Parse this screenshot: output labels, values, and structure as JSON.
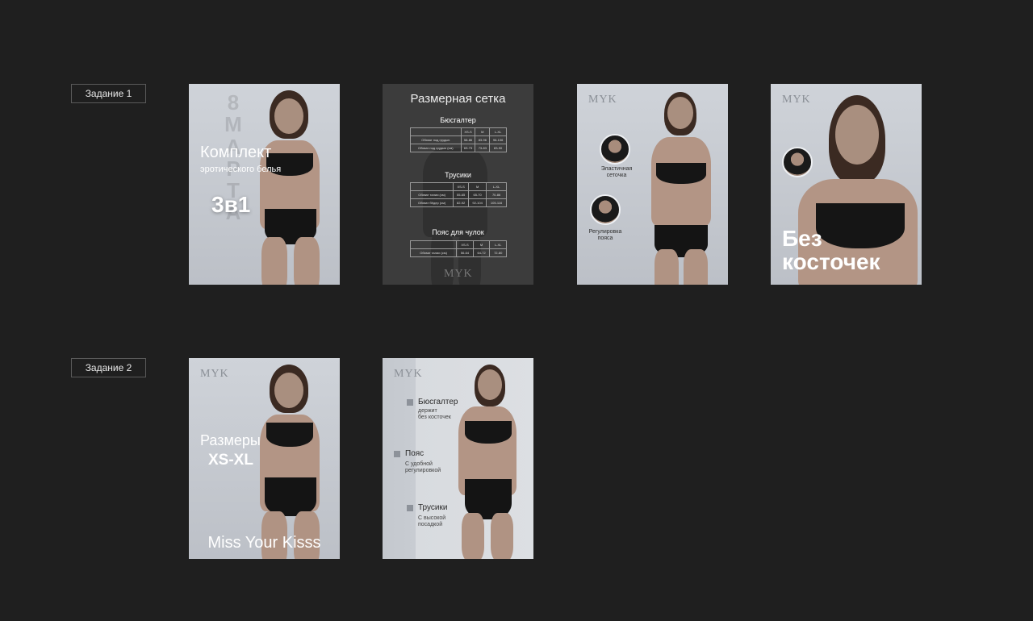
{
  "task1_label": "Задание 1",
  "task2_label": "Задание 2",
  "brand": "MYK",
  "card1": {
    "vertical": [
      "8",
      "М",
      "А",
      "Р",
      "Т",
      "А"
    ],
    "title": "Комплект",
    "subtitle": "эротического белья",
    "set": "3в1"
  },
  "card2": {
    "title": "Размерная сетка",
    "sections": [
      {
        "name": "Бюсгалтер",
        "header": [
          "",
          "XS-S",
          "M",
          "L-XL"
        ],
        "rows": [
          [
            "Обхват под грудью",
            "58-86",
            "83-96",
            "96-106"
          ],
          [
            "Обхват под грудью (см)",
            "63-73",
            "73-83",
            "83-90"
          ]
        ]
      },
      {
        "name": "Трусики",
        "header": [
          "",
          "XS-S",
          "M",
          "L-XL"
        ],
        "rows": [
          [
            "Обхват талии (см)",
            "55-65",
            "65-70",
            "70-86"
          ],
          [
            "Обхват бёдер (см)",
            "82-92",
            "92-104",
            "105-116"
          ]
        ]
      },
      {
        "name": "Пояс для чулок",
        "header": [
          "",
          "XS-S",
          "M",
          "L-XL"
        ],
        "rows": [
          [
            "Обхват талии (см)",
            "56-64",
            "64-72",
            "72-80"
          ]
        ]
      }
    ]
  },
  "card3": {
    "feature1": "Эластичная сеточка",
    "feature2": "Регулировка пояса"
  },
  "card4": {
    "line1": "Без",
    "line2": "косточек"
  },
  "card5": {
    "title": "Размеры",
    "sizes": "XS-XL",
    "slogan": "Miss Your Kisss"
  },
  "card6": {
    "items": [
      {
        "title": "Бюсгалтер",
        "desc1": "держит",
        "desc2": "без косточек"
      },
      {
        "title": "Пояс",
        "desc1": "С удобной",
        "desc2": "регулировкой"
      },
      {
        "title": "Трусики",
        "desc1": "С высокой",
        "desc2": "посадкой"
      }
    ]
  }
}
